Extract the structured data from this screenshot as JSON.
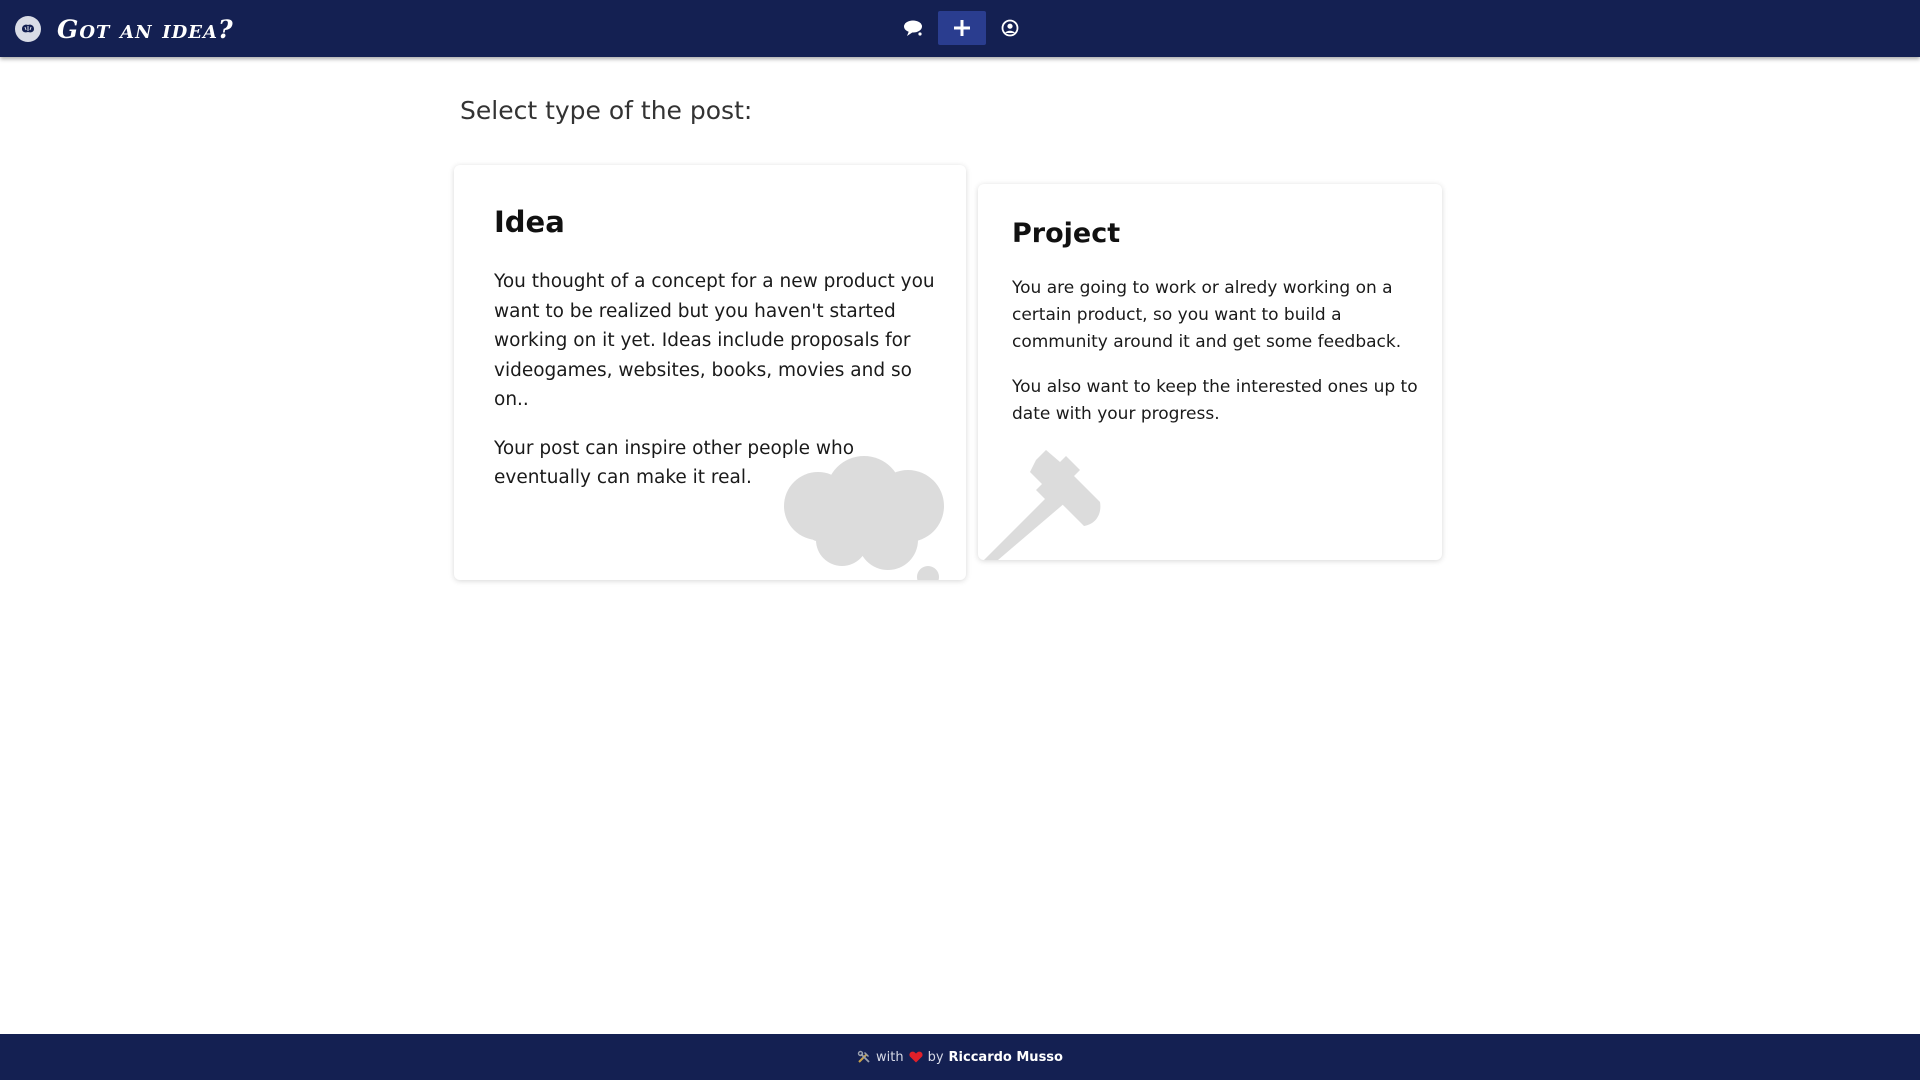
{
  "header": {
    "brand_title": "Got an idea?",
    "nav": [
      {
        "icon": "chat-bubble-icon"
      },
      {
        "icon": "plus-icon",
        "active": true
      },
      {
        "icon": "user-circle-icon"
      }
    ]
  },
  "main": {
    "heading": "Select type of the post:",
    "cards": [
      {
        "title": "Idea",
        "paragraphs": [
          "You thought of a concept for a new product you want to be realized but you haven't started working on it yet. Ideas include proposals for videogames, websites, books, movies and so on..",
          "Your post can inspire other people who eventually can make it real."
        ],
        "decoration_icon": "thought-cloud-icon"
      },
      {
        "title": "Project",
        "paragraphs": [
          "You are going to work or alredy working on a certain product, so you want to build a community around it and get some feedback.",
          "You also want to keep the interested ones up to date with your progress."
        ],
        "decoration_icon": "hammer-icon"
      }
    ]
  },
  "footer": {
    "with": "with",
    "by": "by",
    "author": "Riccardo Musso",
    "tools_icon": "hammer-wrench-icon",
    "heart_icon": "heart-icon",
    "heart_color": "#e0202a"
  },
  "colors": {
    "navbar": "#142052",
    "active_nav": "#2a3d8f",
    "decoration": "#dcdcdc"
  }
}
